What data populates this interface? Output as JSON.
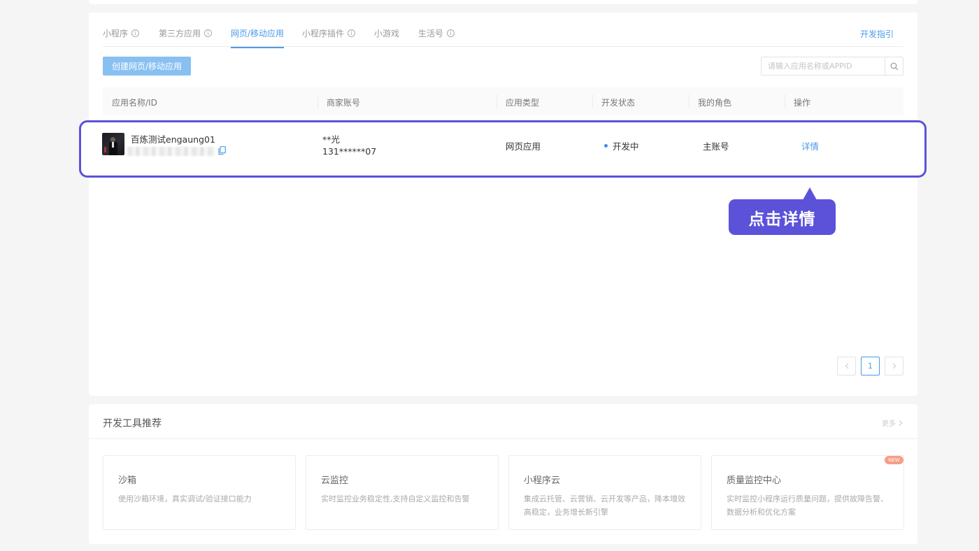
{
  "tabs": [
    {
      "label": "小程序",
      "info": true,
      "active": false
    },
    {
      "label": "第三方应用",
      "info": true,
      "active": false
    },
    {
      "label": "网页/移动应用",
      "info": false,
      "active": true
    },
    {
      "label": "小程序插件",
      "info": true,
      "active": false
    },
    {
      "label": "小游戏",
      "info": false,
      "active": false
    },
    {
      "label": "生活号",
      "info": true,
      "active": false
    }
  ],
  "dev_guide": "开发指引",
  "create_button": "创建网页/移动应用",
  "search": {
    "placeholder": "请输入应用名称或APPID",
    "value": ""
  },
  "table": {
    "headers": [
      "应用名称/ID",
      "商家账号",
      "应用类型",
      "开发状态",
      "我的角色",
      "操作"
    ],
    "rows": [
      {
        "app_name": "百炼测试engaung01",
        "merchant_name": "**光",
        "merchant_phone": "131******07",
        "app_type": "网页应用",
        "status": "开发中",
        "role": "主账号",
        "action": "详情"
      }
    ]
  },
  "callout": "点击详情",
  "pagination": {
    "current": "1"
  },
  "tools": {
    "title": "开发工具推荐",
    "more": "更多",
    "items": [
      {
        "title": "沙箱",
        "desc": "使用沙箱环境，真实调试/验证接口能力"
      },
      {
        "title": "云监控",
        "desc": "实时监控业务稳定性,支持自定义监控和告警"
      },
      {
        "title": "小程序云",
        "desc": "集成云托管、云营销、云开发等产品，降本增效高稳定，业务增长新引擎"
      },
      {
        "title": "质量监控中心",
        "desc": "实时监控小程序运行质量问题，提供故障告警、数据分析和优化方案"
      }
    ],
    "new_badge": "NEW"
  },
  "colors": {
    "accent": "#4b9ae8",
    "highlight": "#5b52d9"
  }
}
